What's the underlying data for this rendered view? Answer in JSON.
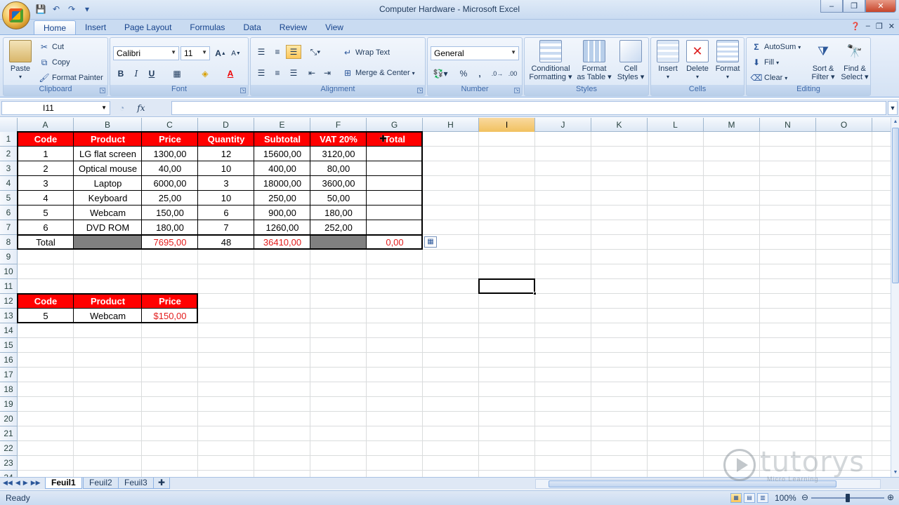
{
  "window": {
    "title": "Computer Hardware - Microsoft Excel",
    "minimize": "–",
    "restore": "❐",
    "close": "✕"
  },
  "quick_access": {
    "save": "💾",
    "undo": "↶",
    "redo": "↷",
    "customize": "▾"
  },
  "menu_tabs": [
    "Home",
    "Insert",
    "Page Layout",
    "Formulas",
    "Data",
    "Review",
    "View"
  ],
  "active_tab": "Home",
  "ribbon": {
    "clipboard": {
      "label": "Clipboard",
      "paste": "Paste",
      "cut": "Cut",
      "copy": "Copy",
      "format_painter": "Format Painter"
    },
    "font": {
      "label": "Font",
      "font_name": "Calibri",
      "font_size": "11",
      "bold": "B",
      "italic": "I",
      "underline": "U"
    },
    "alignment": {
      "label": "Alignment",
      "wrap_text": "Wrap Text",
      "merge_center": "Merge & Center"
    },
    "number": {
      "label": "Number",
      "format": "General",
      "percent": "%",
      "comma": ","
    },
    "styles": {
      "label": "Styles",
      "conditional_1": "Conditional",
      "conditional_2": "Formatting ▾",
      "format_table_1": "Format",
      "format_table_2": "as Table ▾",
      "cell_styles_1": "Cell",
      "cell_styles_2": "Styles ▾"
    },
    "cells": {
      "label": "Cells",
      "insert": "Insert",
      "delete": "Delete",
      "format": "Format"
    },
    "editing": {
      "label": "Editing",
      "autosum": "AutoSum",
      "fill": "Fill",
      "clear": "Clear",
      "sort_1": "Sort &",
      "sort_2": "Filter ▾",
      "find_1": "Find &",
      "find_2": "Select ▾"
    }
  },
  "formula_bar": {
    "name_box": "I11",
    "fx": "fx",
    "formula": ""
  },
  "columns": [
    "A",
    "B",
    "C",
    "D",
    "E",
    "F",
    "G",
    "H",
    "I",
    "J",
    "K",
    "L",
    "M",
    "N",
    "O"
  ],
  "selected_column": "I",
  "rows": [
    "1",
    "2",
    "3",
    "4",
    "5",
    "6",
    "7",
    "8",
    "9",
    "10",
    "11",
    "12",
    "13",
    "14",
    "15",
    "16",
    "17",
    "18",
    "19",
    "20",
    "21",
    "22",
    "23",
    "24"
  ],
  "table1": {
    "headers": [
      "Code",
      "Product",
      "Price",
      "Quantity",
      "Subtotal",
      "VAT 20%",
      "Total"
    ],
    "rows": [
      [
        "1",
        "LG flat screen",
        "1300,00",
        "12",
        "15600,00",
        "3120,00",
        ""
      ],
      [
        "2",
        "Optical mouse",
        "40,00",
        "10",
        "400,00",
        "80,00",
        ""
      ],
      [
        "3",
        "Laptop",
        "6000,00",
        "3",
        "18000,00",
        "3600,00",
        ""
      ],
      [
        "4",
        "Keyboard",
        "25,00",
        "10",
        "250,00",
        "50,00",
        ""
      ],
      [
        "5",
        "Webcam",
        "150,00",
        "6",
        "900,00",
        "180,00",
        ""
      ],
      [
        "6",
        "DVD ROM",
        "180,00",
        "7",
        "1260,00",
        "252,00",
        ""
      ]
    ],
    "total_row": [
      "Total",
      "",
      "7695,00",
      "48",
      "36410,00",
      "",
      "0,00"
    ]
  },
  "table2": {
    "headers": [
      "Code",
      "Product",
      "Price"
    ],
    "row": [
      "5",
      "Webcam",
      "$150,00"
    ]
  },
  "sheets": [
    "Feuil1",
    "Feuil2",
    "Feuil3"
  ],
  "active_sheet": "Feuil1",
  "status": {
    "text": "Ready",
    "zoom": "100%"
  },
  "watermark": {
    "brand": "tutorys",
    "sub": "Micro Learning"
  }
}
